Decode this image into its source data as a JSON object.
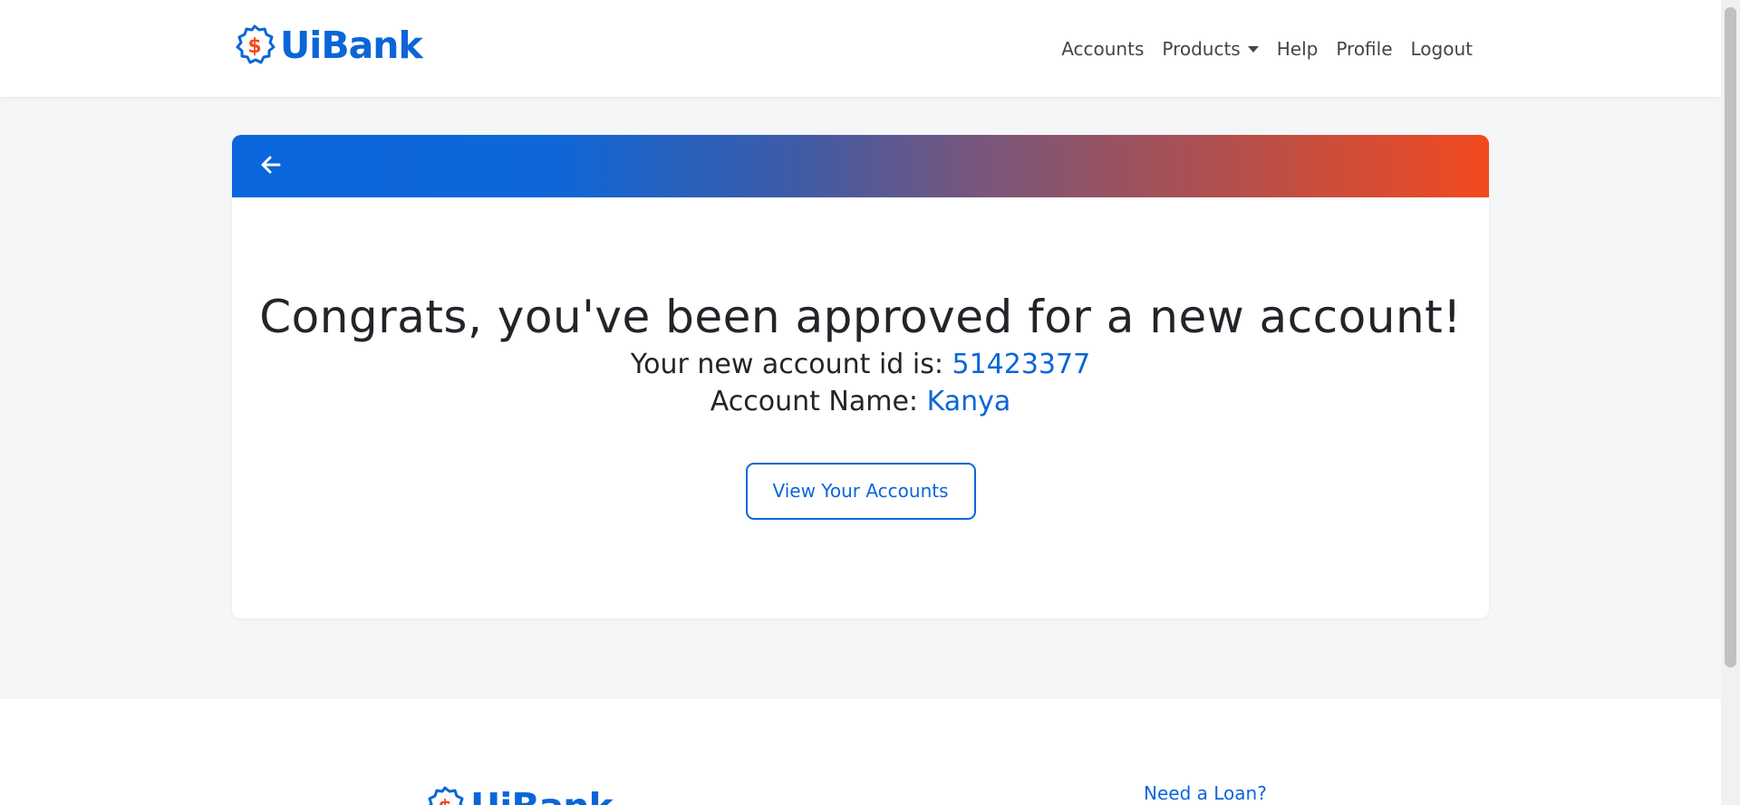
{
  "brand": {
    "name": "UiBank",
    "logo_symbol": "$",
    "logo_icon": "badge-dollar-icon",
    "primary_color": "#0a66d8",
    "accent_color": "#f24a1f"
  },
  "nav": {
    "items": [
      {
        "label": "Accounts"
      },
      {
        "label": "Products",
        "has_dropdown": true
      },
      {
        "label": "Help"
      },
      {
        "label": "Profile"
      },
      {
        "label": "Logout"
      }
    ]
  },
  "card": {
    "back_icon": "arrow-left-icon",
    "headline": "Congrats, you've been approved for a new account!",
    "account_id_label": "Your new account id is:",
    "account_id_value": "51423377",
    "account_name_label": "Account Name:",
    "account_name_value": "Kanya",
    "cta_label": "View Your Accounts"
  },
  "footer": {
    "link_label": "Need a Loan?"
  }
}
